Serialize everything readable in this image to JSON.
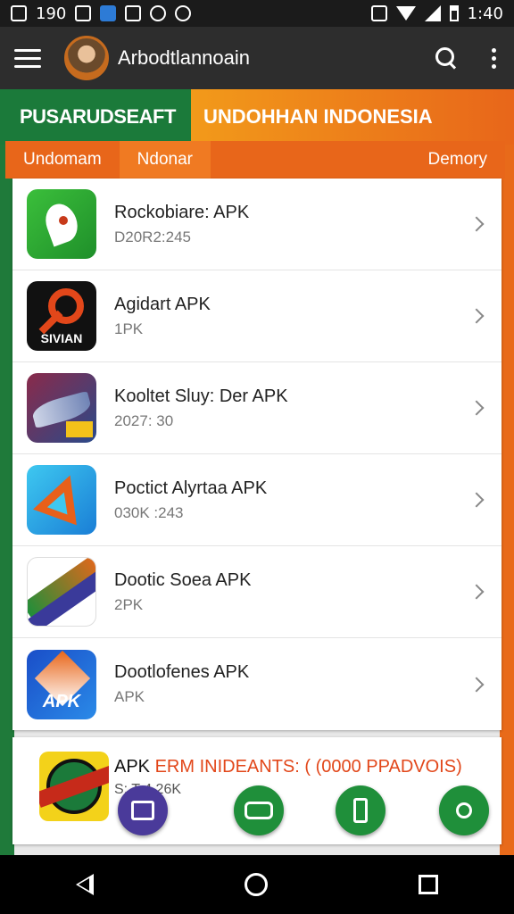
{
  "statusbar": {
    "left_text": "190",
    "time": "1:40"
  },
  "appbar": {
    "title": "Arbodtlannoain"
  },
  "banner": {
    "left": "PUSARUDSEAFT",
    "right": "UNDOHHAN INDONESIA"
  },
  "tabs": [
    {
      "label": "Undomam"
    },
    {
      "label": "Ndonar"
    },
    {
      "label": "Demory"
    }
  ],
  "list": [
    {
      "title": "Rockobiare: APK",
      "sub": "D20R2:245"
    },
    {
      "title": "Agidart APK",
      "sub": "1PK"
    },
    {
      "title": "Kooltet Sluy: Der APK",
      "sub": "2027: 30"
    },
    {
      "title": "Poctict Alyrtaa APK",
      "sub": "030K :243"
    },
    {
      "title": "Dootic Soea APK",
      "sub": "2PK"
    },
    {
      "title": "Dootlofenes APK",
      "sub": "APK"
    }
  ],
  "icon_labels": {
    "app2": "SIVIAN",
    "app6": "APK"
  },
  "card2": {
    "title_a": "APK ",
    "title_b": "ERM INIDEANTS: ( (0000 PPADVOIS)",
    "sub": "S: T 4 26K"
  },
  "icons": [
    "hamburger-icon",
    "search-icon",
    "more-vert-icon"
  ],
  "colors": {
    "green": "#1f7a3a",
    "orange": "#e8661a",
    "appbar": "#2d2d2d"
  }
}
